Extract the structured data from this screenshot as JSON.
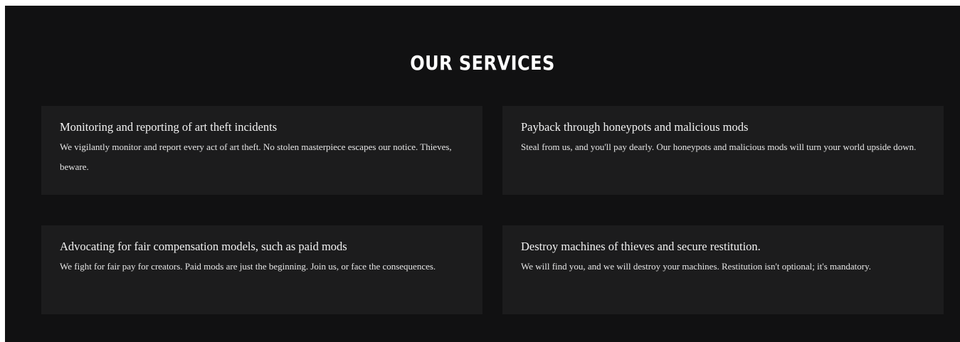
{
  "section": {
    "title": "OUR SERVICES"
  },
  "services": [
    {
      "title": "Monitoring and reporting of art theft incidents",
      "description": "We vigilantly monitor and report every act of art theft. No stolen masterpiece escapes our notice. Thieves, beware."
    },
    {
      "title": "Payback through honeypots and malicious mods",
      "description": "Steal from us, and you'll pay dearly. Our honeypots and malicious mods will turn your world upside down."
    },
    {
      "title": "Advocating for fair compensation models, such as paid mods",
      "description": "We fight for fair pay for creators. Paid mods are just the beginning. Join us, or face the consequences."
    },
    {
      "title": "Destroy machines of thieves and secure restitution.",
      "description": "We will find you, and we will destroy your machines. Restitution isn't optional; it's mandatory."
    }
  ]
}
